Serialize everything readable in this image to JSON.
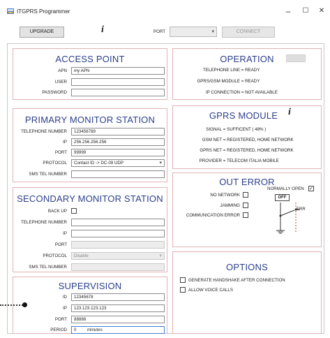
{
  "window": {
    "title": "ITGPRS Programmer",
    "minimize": "–",
    "maximize": "☐",
    "close": "✕"
  },
  "toolbar": {
    "upgrade_label": "UPGRADE",
    "info_glyph": "i",
    "port_label": "PORT",
    "port_value": "",
    "connect_label": "CONNECT"
  },
  "access_point": {
    "title": "ACCESS POINT",
    "apn_label": "APN",
    "apn_value": "my APN",
    "user_label": "USER",
    "user_value": "",
    "password_label": "PASSWORD",
    "password_value": ""
  },
  "primary": {
    "title": "PRIMARY MONITOR STATION",
    "phone_label": "TELEPHONE NUMBER",
    "phone_value": "123456789",
    "ip_label": "IP",
    "ip_value": "256.256.256.256",
    "port_label": "PORT",
    "port_value": "99999",
    "protocol_label": "PROTOCOL",
    "protocol_value": "Contact ID  ->  DC-09  UDP",
    "sms_label": "SMS TEL NUMBER",
    "sms_value": ""
  },
  "secondary": {
    "title": "SECONDARY MONITOR STATION",
    "backup_label": "BACK UP",
    "phone_label": "TELEPHONE NUMBER",
    "phone_value": "",
    "ip_label": "IP",
    "ip_value": "",
    "port_label": "PORT",
    "port_value": "",
    "protocol_label": "PROTOCOL",
    "protocol_value": "Disable",
    "sms_label": "SMS TEL NUMBER",
    "sms_value": ""
  },
  "supervision": {
    "title": "SUPERVISION",
    "id_label": "ID",
    "id_value": "12345678",
    "ip_label": "IP",
    "ip_value": "123.123.123.123",
    "port_label": "PORT",
    "port_value": "88888",
    "period_label": "PERIOD",
    "period_value": "0",
    "period_unit": "minutes"
  },
  "operation": {
    "title": "OPERATION",
    "rows": [
      {
        "key": "TELEPHONE LINE",
        "value": "READY"
      },
      {
        "key": "GPRS/GSM MODULE",
        "value": "READY"
      },
      {
        "key": "IP CONNECTION",
        "value": "NOT AVAILABLE"
      }
    ]
  },
  "gprs": {
    "title": "GPRS MODULE",
    "info_glyph": "i",
    "rows": [
      {
        "key": "SIGNAL",
        "value": "SUFFICENT  ( 48% )"
      },
      {
        "key": "GSM NET",
        "value": "REGISTERED, HOME NETWORK"
      },
      {
        "key": "GPRS NET",
        "value": "REGISTERED, HOME NETWORK"
      },
      {
        "key": "PROVIDER",
        "value": "TELECOM ITALIA MOBILE"
      }
    ]
  },
  "out_error": {
    "title": "OUT ERROR",
    "no_network": "NO NETWORK",
    "jamming": "JAMMING",
    "comm_error": "COMMUNICATION ERROR",
    "normally_open": "NORMALLY OPEN",
    "off_label": "OFF",
    "err_label": "ERR"
  },
  "options": {
    "title": "OPTIONS",
    "handshake": "GENERATE HANDSHAKE AFTER CONNECTION",
    "voice": "ALLOW VOICE CALLS"
  },
  "colors": {
    "title_blue": "#2b3e8c",
    "panel_border": "#e0b3b3",
    "relay_red": "#d33"
  }
}
